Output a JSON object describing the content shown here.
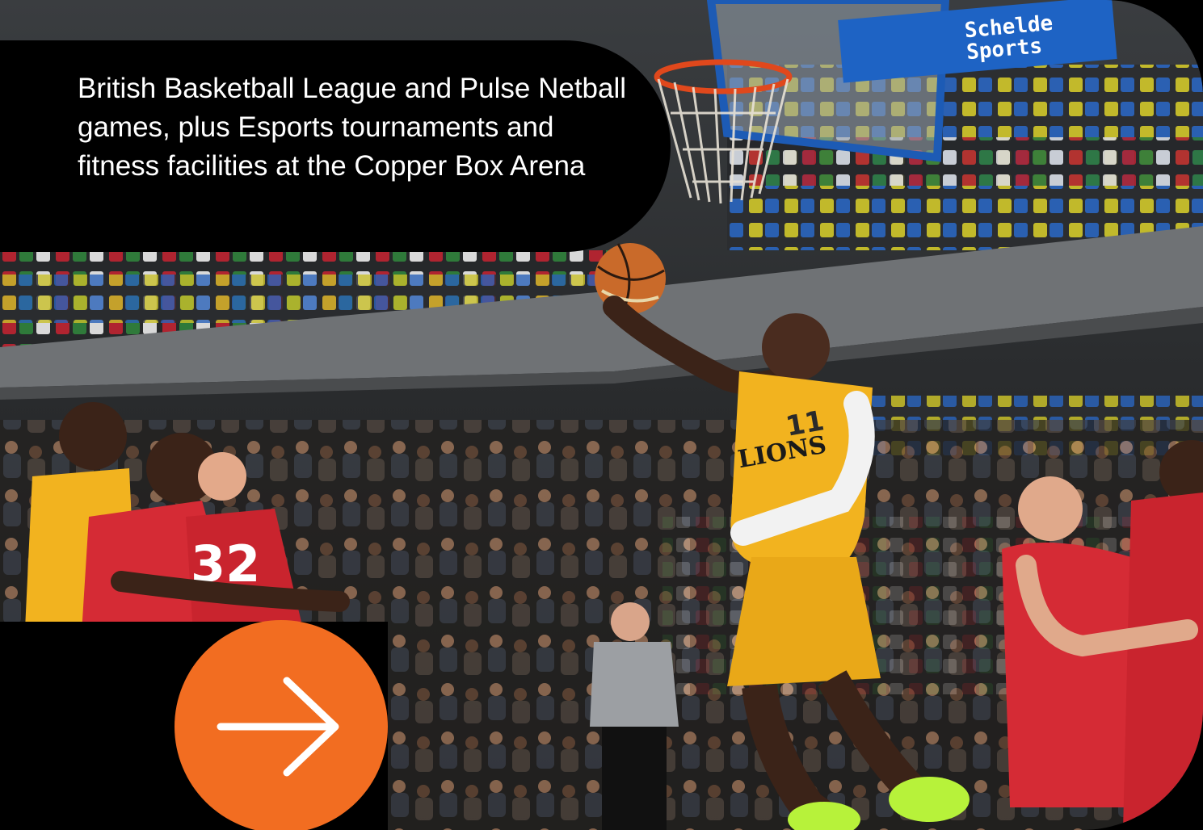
{
  "caption": {
    "text": "British Basketball League and Pulse Netball games, plus Esports tournaments and fitness facilities at the Copper Box Arena"
  },
  "photo": {
    "sponsor_text_line1": "Schelde",
    "sponsor_text_line2": "Sports",
    "player_number": "11",
    "opponent_number": "32",
    "jersey_text": "LIONS"
  },
  "cta": {
    "icon": "arrow-right-icon",
    "color": "#f26d21"
  },
  "colors": {
    "background": "#000000",
    "accent": "#f26d21",
    "text": "#ffffff"
  }
}
